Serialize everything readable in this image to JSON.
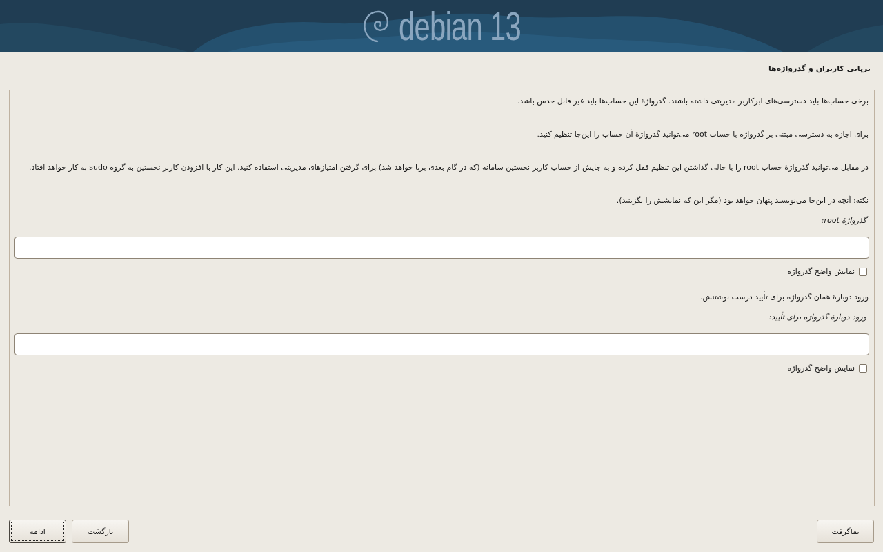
{
  "header": {
    "logo_text": "debian 13"
  },
  "title": "برپایی کاربران و گذرواژه‌ها",
  "panel": {
    "items": [
      {
        "kind": "text",
        "text": "برخی حساب‌ها باید دسترسی‌های ابرکاربر مدیریتی داشته باشند. گذرواژهٔ این حساب‌ها باید غیر قابل حدس باشد."
      },
      {
        "kind": "text",
        "text": "برای اجازه به دسترسی مبتنی بر گذرواژه با حساب root می‌توانید گذرواژهٔ آن حساب را این‌جا تنظیم کنید."
      },
      {
        "kind": "text",
        "text": "در مقابل می‌توانید گذرواژهٔ حساب root را با خالی گذاشتن این تنظیم قفل کرده و به جایش از حساب کاربر نخستین سامانه (که در گام بعدی برپا خواهد شد) برای گرفتن امتیازهای مدیریتی استفاده کنید. این کار با افزودن کاربر نخستین به گروه sudo به کار خواهد افتاد."
      },
      {
        "kind": "text",
        "text": "نکته: آنچه در این‌جا می‌نویسید پنهان خواهد بود (مگر این که نمایشش را بگزینید)."
      },
      {
        "kind": "label",
        "text": "گذرواژهٔ root:"
      },
      {
        "kind": "password"
      },
      {
        "kind": "checkbox",
        "label": "نمایش واضح گذرواژه",
        "checked": false
      },
      {
        "kind": "text",
        "text": "ورود دوبارهٔ همان گذرواژه برای تأیید درست نوشتنش."
      },
      {
        "kind": "label",
        "text": "ورود دوبارهٔ گذرواژه برای تأیید:"
      },
      {
        "kind": "password"
      },
      {
        "kind": "checkbox",
        "label": "نمایش واضح گذرواژه",
        "checked": false
      }
    ]
  },
  "footer": {
    "right_buttons": [
      {
        "label": "نماگرفت",
        "focused": false
      }
    ],
    "left_buttons": [
      {
        "label": "بازگشت",
        "focused": false
      },
      {
        "label": "ادامه",
        "focused": true
      }
    ]
  }
}
